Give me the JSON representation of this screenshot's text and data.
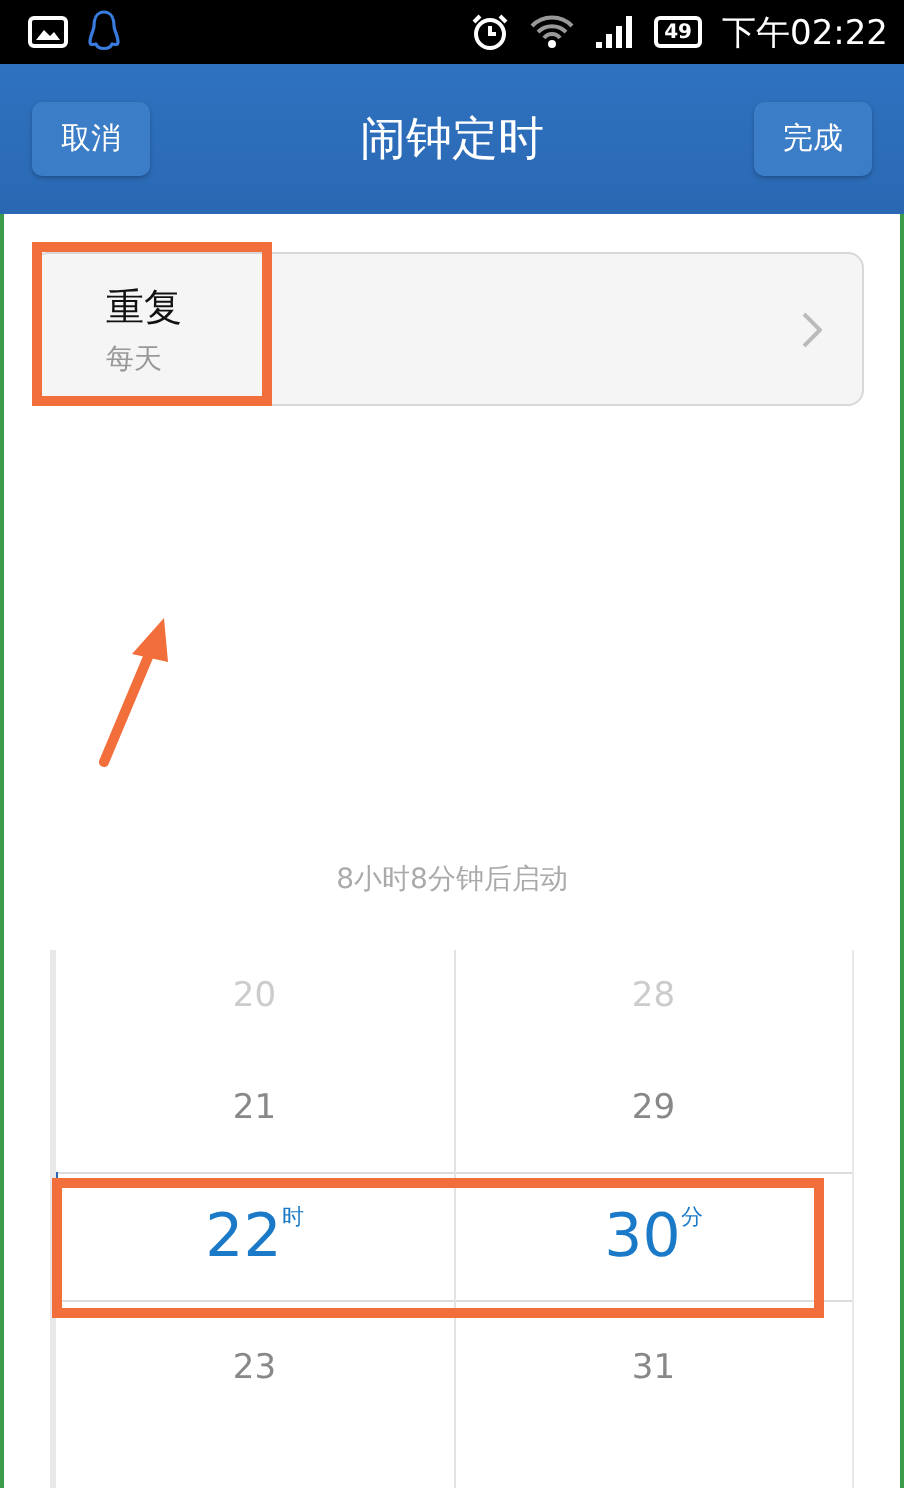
{
  "status_bar": {
    "battery": "49",
    "time": "下午02:22"
  },
  "header": {
    "title": "闹钟定时",
    "left_button": "取消",
    "right_button": "完成"
  },
  "repeat": {
    "label": "重复",
    "value": "每天"
  },
  "hint": "8小时8分钟后启动",
  "picker": {
    "columns": [
      {
        "unit": "时",
        "items": [
          {
            "value": "20",
            "selected": false
          },
          {
            "value": "21",
            "selected": false
          },
          {
            "value": "22",
            "selected": true
          },
          {
            "value": "23",
            "selected": false
          }
        ]
      },
      {
        "unit": "分",
        "items": [
          {
            "value": "28",
            "selected": false
          },
          {
            "value": "29",
            "selected": false
          },
          {
            "value": "30",
            "selected": true
          },
          {
            "value": "31",
            "selected": false
          }
        ]
      }
    ]
  }
}
